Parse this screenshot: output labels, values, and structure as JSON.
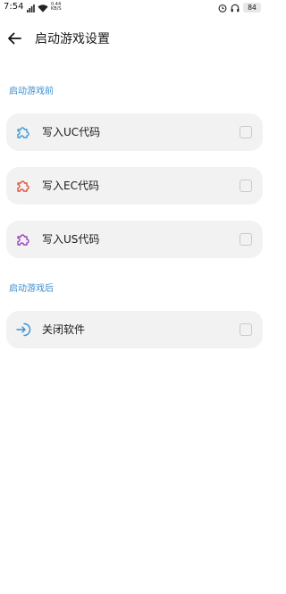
{
  "status_bar": {
    "time": "7:54",
    "net_speed_value": "0.44",
    "net_speed_unit": "KB/S",
    "battery": "84"
  },
  "header": {
    "title": "启动游戏设置"
  },
  "sections": [
    {
      "title": "启动游戏前",
      "items": [
        {
          "label": "写入UC代码",
          "icon": "puzzle-icon",
          "icon_color": "#3a9ad9",
          "checked": false
        },
        {
          "label": "写入EC代码",
          "icon": "puzzle-icon",
          "icon_color": "#e2533c",
          "checked": false
        },
        {
          "label": "写入US代码",
          "icon": "puzzle-icon",
          "icon_color": "#9b3fc1",
          "checked": false
        }
      ]
    },
    {
      "title": "启动游戏后",
      "items": [
        {
          "label": "关闭软件",
          "icon": "exit-arrow-icon",
          "icon_color": "#3a8fd6",
          "checked": false
        }
      ]
    }
  ]
}
